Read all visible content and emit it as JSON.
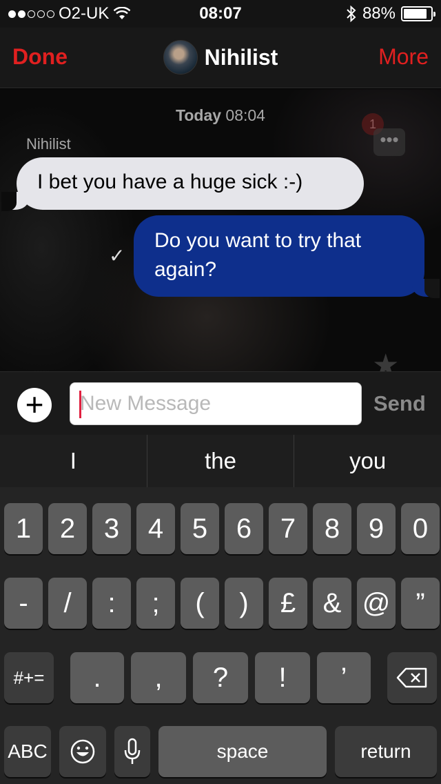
{
  "status_bar": {
    "signal_dots": 5,
    "signal_filled": 2,
    "carrier": "O2-UK",
    "time": "08:07",
    "battery": "88%",
    "battery_level": 0.88,
    "icons": [
      "wifi-icon",
      "bluetooth-icon",
      "battery-icon"
    ]
  },
  "nav": {
    "done_label": "Done",
    "title": "Nihilist",
    "more_label": "More",
    "accent_color": "#e02020"
  },
  "chat": {
    "date_day": "Today",
    "date_time": "08:04",
    "sender_name": "Nihilist",
    "unread_badge": "1",
    "messages": [
      {
        "direction": "incoming",
        "text": "I bet you have a huge sick :-)"
      },
      {
        "direction": "outgoing",
        "text": "Do you want to try that again?",
        "status_icon": "✓"
      }
    ],
    "incoming_color": "#e5e5ea",
    "outgoing_color": "#0e2f8c"
  },
  "input": {
    "placeholder": "New Message",
    "value": "",
    "send_label": "Send"
  },
  "suggestions": [
    "I",
    "the",
    "you"
  ],
  "keyboard": {
    "row1": [
      "1",
      "2",
      "3",
      "4",
      "5",
      "6",
      "7",
      "8",
      "9",
      "0"
    ],
    "row2": [
      "-",
      "/",
      ":",
      ";",
      "(",
      ")",
      "£",
      "&",
      "@",
      "”"
    ],
    "row3": {
      "symbols_label": "#+=",
      "keys": [
        ".",
        ",",
        "?",
        "!",
        "’"
      ],
      "delete_icon": "backspace-icon"
    },
    "row4": {
      "abc_label": "ABC",
      "emoji_icon": "emoji-icon",
      "mic_icon": "microphone-icon",
      "space_label": "space",
      "return_label": "return"
    }
  }
}
